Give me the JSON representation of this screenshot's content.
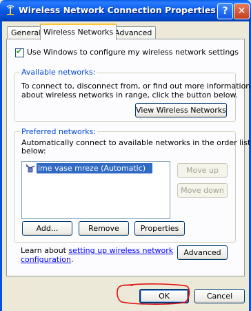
{
  "window": {
    "title": "Wireless Network Connection Properties",
    "help_label": "?",
    "close_label": "✕"
  },
  "tabs": [
    {
      "label": "General",
      "active": false
    },
    {
      "label": "Wireless Networks",
      "active": true
    },
    {
      "label": "Advanced",
      "active": false
    }
  ],
  "use_windows_checkbox": {
    "label": "Use Windows to configure my wireless network settings",
    "checked": true
  },
  "available_networks": {
    "legend": "Available networks:",
    "text_line1": "To connect to, disconnect from, or find out more information",
    "text_line2": "about wireless networks in range, click the button below.",
    "view_button": "View Wireless Networks"
  },
  "preferred_networks": {
    "legend": "Preferred networks:",
    "text_line1": "Automatically connect to available networks in the order listed",
    "text_line2": "below:",
    "items": [
      {
        "label": "ime vase mreze (Automatic)",
        "selected": true
      }
    ],
    "move_up": "Move up",
    "move_down": "Move down",
    "add": "Add...",
    "remove": "Remove",
    "properties": "Properties"
  },
  "learn_about": {
    "prefix": "Learn about ",
    "link_line1": "setting up wireless network",
    "link_line2": "configuration",
    "suffix": ".",
    "advanced_button": "Advanced"
  },
  "footer": {
    "ok": "OK",
    "cancel": "Cancel"
  },
  "colors": {
    "titlebar": "#0558e4",
    "legend": "#0046d5",
    "selection": "#316ac5",
    "annotation": "#e01010"
  }
}
